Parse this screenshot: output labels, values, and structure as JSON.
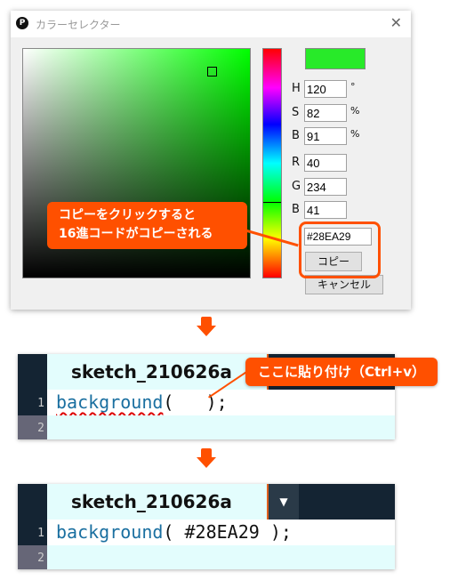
{
  "dialog": {
    "title": "カラーセレクター",
    "app_icon": "processing-logo-icon",
    "close_icon": "close-icon",
    "close_glyph": "✕",
    "preview_color": "#28EA29",
    "fields": [
      {
        "label": "H",
        "value": "120",
        "unit": "°"
      },
      {
        "label": "S",
        "value": "82",
        "unit": "%"
      },
      {
        "label": "B",
        "value": "91",
        "unit": "%"
      },
      {
        "label": "R",
        "value": "40",
        "unit": ""
      },
      {
        "label": "G",
        "value": "234",
        "unit": ""
      },
      {
        "label": "B",
        "value": "41",
        "unit": ""
      }
    ],
    "hex_value": "#28EA29",
    "copy_label": "コピー",
    "cancel_label": "キャンセル"
  },
  "annotations": {
    "copy_callout_line1": "コピーをクリックすると",
    "copy_callout_line2": "16進コードがコピーされる",
    "paste_callout": "ここに貼り付け（Ctrl+v）"
  },
  "editor_before": {
    "tab_label": "sketch_210626a",
    "line_numbers": [
      "1",
      "2"
    ],
    "code_fn": "background",
    "code_rest": "(   );"
  },
  "editor_after": {
    "tab_label": "sketch_210626a",
    "tab_menu_glyph": "▼",
    "line_numbers": [
      "1",
      "2"
    ],
    "code_fn": "background",
    "code_rest": "( #28EA29 );"
  }
}
